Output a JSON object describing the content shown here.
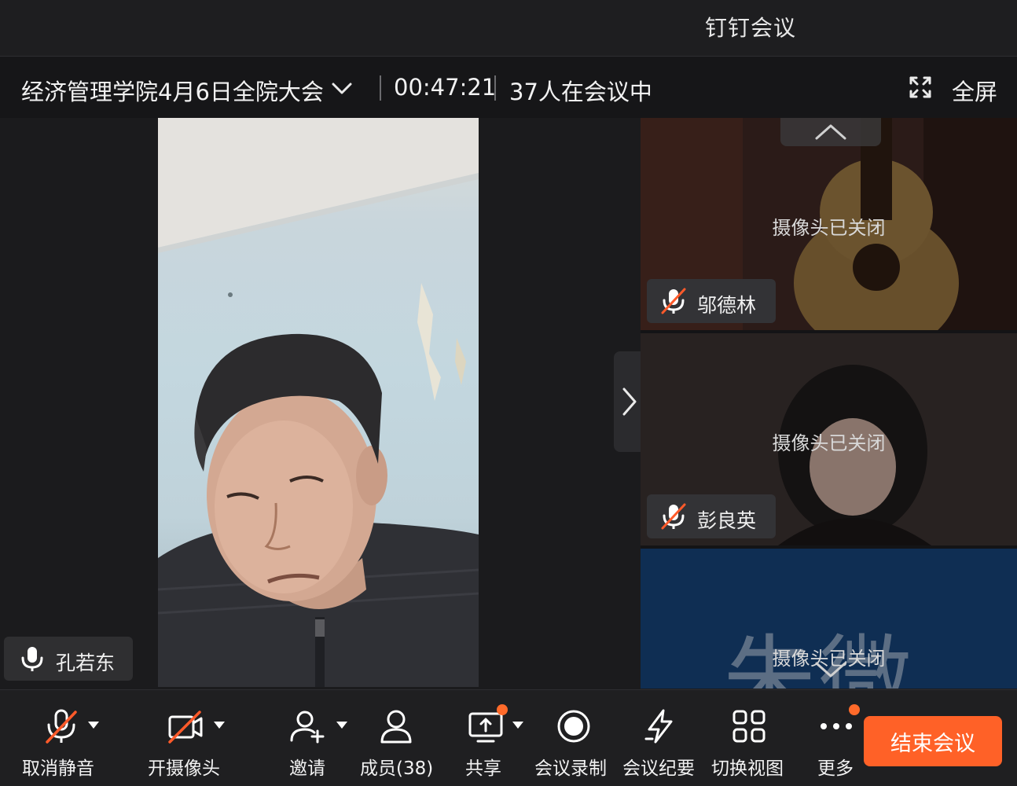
{
  "app": {
    "title": "钉钉会议"
  },
  "meeting": {
    "name": "经济管理学院4月6日全院大会",
    "elapsed": "00:47:21",
    "participants_text": "37人在会议中",
    "fullscreen_label": "全屏"
  },
  "main_speaker": {
    "name": "孔若东",
    "mic_state": "on"
  },
  "participants": [
    {
      "name": "邬德林",
      "status": "摄像头已关闭",
      "mic_state": "muted"
    },
    {
      "name": "彭良英",
      "status": "摄像头已关闭",
      "mic_state": "muted"
    },
    {
      "name": "",
      "avatar_text": "朱微",
      "status": "摄像头已关闭",
      "mic_state": "unknown"
    }
  ],
  "toolbar": {
    "unmute": "取消静音",
    "camera_on": "开摄像头",
    "invite": "邀请",
    "members": "成员(38)",
    "share": "共享",
    "record": "会议录制",
    "minutes": "会议纪要",
    "switch_view": "切换视图",
    "more": "更多",
    "end_meeting": "结束会议"
  },
  "colors": {
    "accent": "#ff6127",
    "muted_slash": "#ff5a2a",
    "badge": "#ff6a2a",
    "background": "#1b1b1d"
  },
  "icons": [
    "chevron-down-icon",
    "fullscreen-icon",
    "mic-icon",
    "mic-muted-icon",
    "camera-off-icon",
    "invite-user-icon",
    "members-icon",
    "share-screen-icon",
    "record-icon",
    "minutes-icon",
    "grid-view-icon",
    "more-icon",
    "chevron-up-icon",
    "chevron-right-icon"
  ]
}
